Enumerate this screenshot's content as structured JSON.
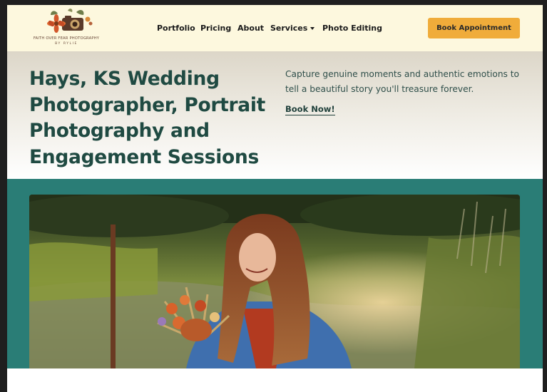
{
  "header": {
    "logo": {
      "name": "FAITH OVER FEAR PHOTOGRAPHY",
      "byline": "BY RYLIE"
    },
    "nav": [
      {
        "label": "Portfolio"
      },
      {
        "label": "Pricing"
      },
      {
        "label": "About"
      },
      {
        "label": "Services",
        "has_dropdown": true
      },
      {
        "label": "Photo Editing"
      }
    ],
    "cta_label": "Book Appointment"
  },
  "hero": {
    "title": "Hays, KS Wedding Photographer, Portrait Photography and Engagement Sessions",
    "copy": "Capture genuine moments and authentic emotions to tell a beautiful story you'll treasure forever.",
    "link_label": "Book Now!"
  },
  "colors": {
    "header_bg": "#fdf8de",
    "accent": "#f0ac3a",
    "title": "#1f4a42",
    "teal_band": "#2a7d76"
  },
  "icons": {
    "dropdown": "chevron-down-icon"
  }
}
